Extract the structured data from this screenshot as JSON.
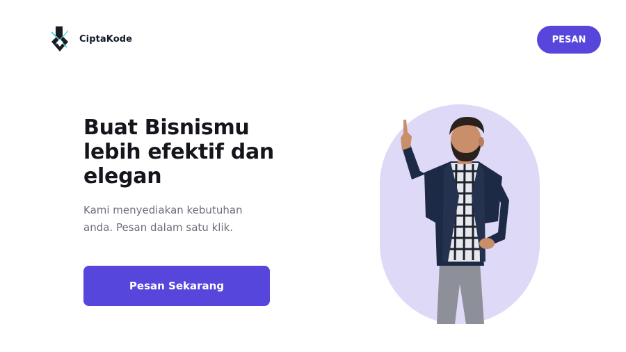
{
  "header": {
    "brand_name": "CiptaKode",
    "logo_icon": "ciptakode-logo-icon",
    "nav_button_label": "PESAN"
  },
  "hero": {
    "headline_lines": [
      "Buat Bisnismu",
      "lebih efektif dan",
      "elegan"
    ],
    "subtext_lines": [
      "Kami menyediakan kebutuhan",
      "anda. Pesan dalam satu klik."
    ],
    "cta_label": "Pesan Sekarang",
    "image_subject": "man-pointing-up"
  },
  "colors": {
    "accent": "#5646dc",
    "headline": "#14161c",
    "subtext": "#6b6f7a",
    "hero_backdrop": "#ddd9f7",
    "logo_accent": "#3fd0d4"
  }
}
